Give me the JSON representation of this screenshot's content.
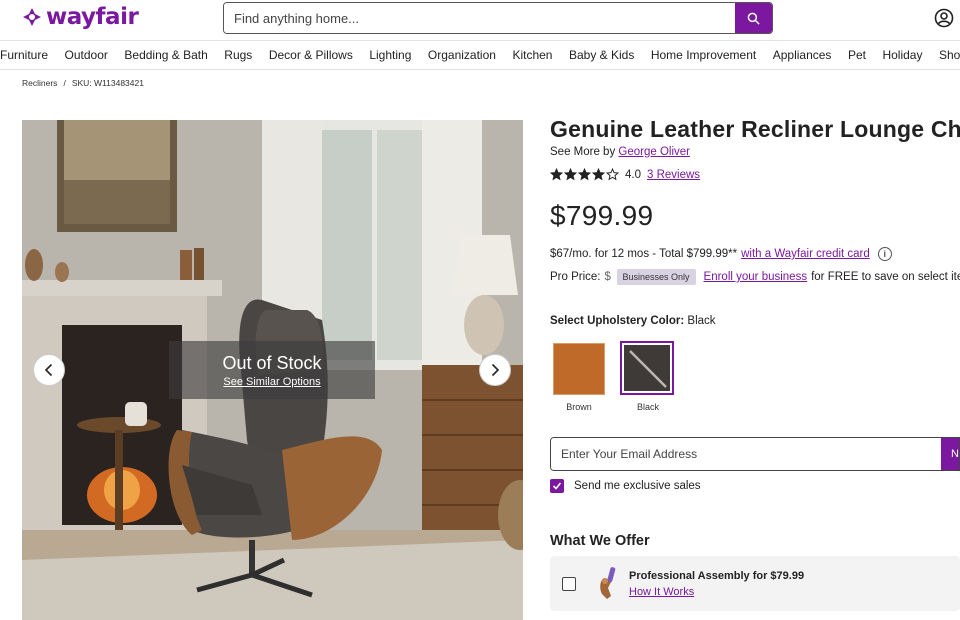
{
  "brand": {
    "name": "wayfair",
    "color": "#7b189f"
  },
  "search": {
    "placeholder": "Find anything home..."
  },
  "nav": {
    "items": [
      "Furniture",
      "Outdoor",
      "Bedding & Bath",
      "Rugs",
      "Decor & Pillows",
      "Lighting",
      "Organization",
      "Kitchen",
      "Baby & Kids",
      "Home Improvement",
      "Appliances",
      "Pet",
      "Holiday",
      "Shop by Room"
    ]
  },
  "breadcrumb": {
    "category": "Recliners",
    "separator": "/",
    "sku": "SKU: W113483421"
  },
  "gallery": {
    "status_title": "Out of Stock",
    "status_link": "See Similar Options"
  },
  "product": {
    "title": "Genuine Leather Recliner Lounge Chair",
    "see_more_prefix": "See More by",
    "brand_link": "George Oliver",
    "rating_value": "4.0",
    "rating_stars": 4,
    "reviews_link": "3 Reviews",
    "price": "$799.99",
    "finance_text": "$67/mo. for 12 mos - Total $799.99**",
    "finance_link": "with a Wayfair credit card",
    "pro_label": "Pro Price:",
    "pro_value": "$",
    "business_badge": "Businesses Only",
    "enroll_link": "Enroll your business",
    "enroll_suffix": "for FREE to save on select items."
  },
  "color_select": {
    "label": "Select Upholstery Color:",
    "selected": "Black",
    "options": [
      {
        "name": "Brown",
        "hex": "#c06a2a"
      },
      {
        "name": "Black",
        "hex": "#3d3a38"
      }
    ]
  },
  "newsletter": {
    "placeholder": "Enter Your Email Address",
    "button_label": "N",
    "opt_in_label": "Send me exclusive sales",
    "opt_in_checked": true
  },
  "offers": {
    "heading": "What We Offer",
    "assembly_title": "Professional Assembly for $79.99",
    "assembly_link": "How It Works"
  }
}
